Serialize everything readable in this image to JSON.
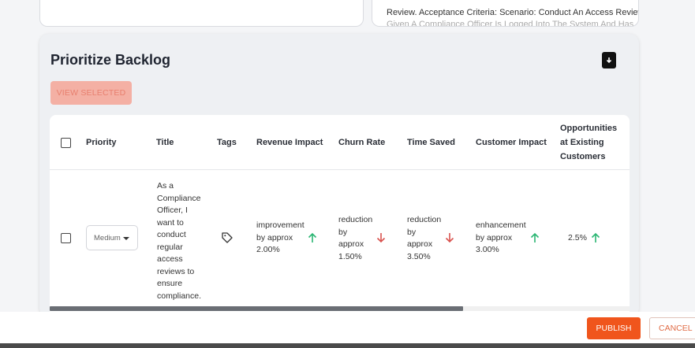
{
  "top_cards": {
    "description_line1": "Review. Acceptance Criteria: Scenario: Conduct An Access Review",
    "description_line2": "Given A Compliance Officer Is Logged Into The System And Has"
  },
  "panel": {
    "title": "Prioritize Backlog",
    "view_selected_label": "VIEW SELECTED"
  },
  "table": {
    "headers": {
      "priority": "Priority",
      "title": "Title",
      "tags": "Tags",
      "revenue_impact": "Revenue Impact",
      "churn_rate": "Churn Rate",
      "time_saved": "Time Saved",
      "customer_impact": "Customer Impact",
      "opportunities_line1": "Opportunities",
      "opportunities_line2": "at Existing",
      "opportunities_line3": "Customers"
    },
    "rows": [
      {
        "priority": "Medium",
        "title_lines": [
          "As a",
          "Compliance",
          "Officer, I",
          "want to",
          "conduct",
          "regular",
          "access",
          "reviews to",
          "ensure",
          "compliance."
        ],
        "revenue_impact_lines": [
          "improvement",
          "by approx",
          "2.00%"
        ],
        "revenue_trend": "up",
        "churn_rate_lines": [
          "reduction",
          "by",
          "approx",
          "1.50%"
        ],
        "churn_trend": "down",
        "time_saved_lines": [
          "reduction",
          "by",
          "approx",
          "3.50%"
        ],
        "time_trend": "down",
        "customer_impact_lines": [
          "enhancement",
          "by approx",
          "3.00%"
        ],
        "customer_trend": "up",
        "opportunities": "2.5%",
        "opportunities_trend": "up"
      }
    ]
  },
  "footer": {
    "publish_label": "PUBLISH",
    "cancel_label": "CANCEL"
  },
  "colors": {
    "accent": "#f0551c",
    "up_arrow": "#2bb673",
    "down_arrow": "#d9534f"
  },
  "icons": {
    "download": "download-file-icon",
    "tag": "tag-icon",
    "up": "arrow-up-icon",
    "down": "arrow-down-icon"
  }
}
